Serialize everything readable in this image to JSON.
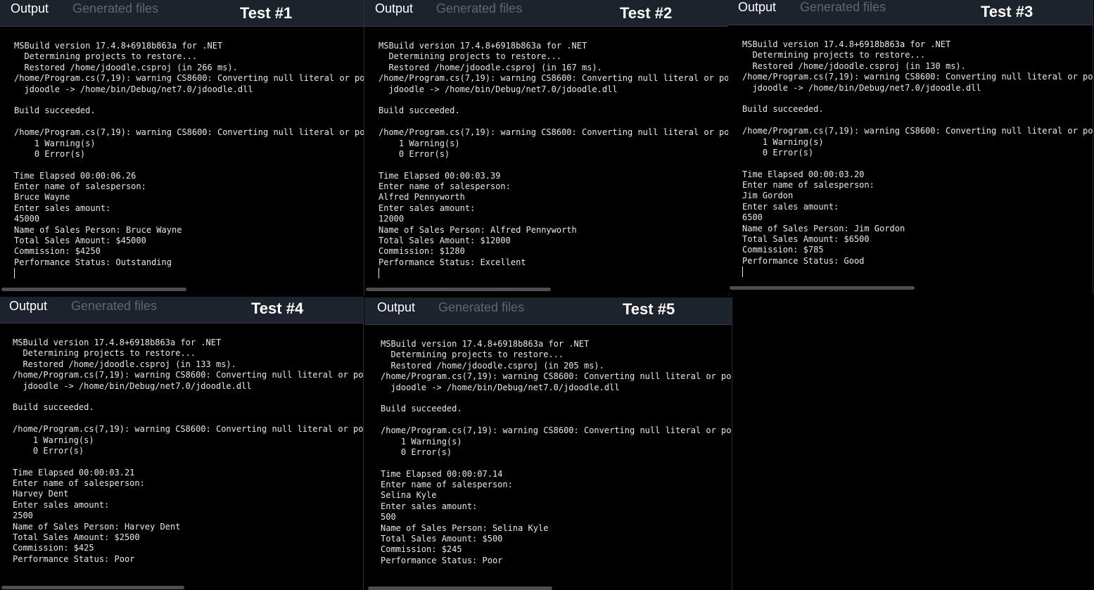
{
  "tabs": {
    "output": "Output",
    "generated_files": "Generated files"
  },
  "panels": [
    {
      "label": "Test #1",
      "lines": [
        "MSBuild version 17.4.8+6918b863a for .NET",
        "  Determining projects to restore...",
        "  Restored /home/jdoodle.csproj (in 266 ms).",
        "/home/Program.cs(7,19): warning CS8600: Converting null literal or po",
        "  jdoodle -> /home/bin/Debug/net7.0/jdoodle.dll",
        "",
        "Build succeeded.",
        "",
        "/home/Program.cs(7,19): warning CS8600: Converting null literal or po",
        "    1 Warning(s)",
        "    0 Error(s)",
        "",
        "Time Elapsed 00:00:06.26",
        "Enter name of salesperson:",
        "Bruce Wayne",
        "Enter sales amount:",
        "45000",
        "Name of Sales Person: Bruce Wayne",
        "Total Sales Amount: $45000",
        "Commission: $4250",
        "Performance Status: Outstanding"
      ]
    },
    {
      "label": "Test #2",
      "lines": [
        "MSBuild version 17.4.8+6918b863a for .NET",
        "  Determining projects to restore...",
        "  Restored /home/jdoodle.csproj (in 167 ms).",
        "/home/Program.cs(7,19): warning CS8600: Converting null literal or po",
        "  jdoodle -> /home/bin/Debug/net7.0/jdoodle.dll",
        "",
        "Build succeeded.",
        "",
        "/home/Program.cs(7,19): warning CS8600: Converting null literal or po",
        "    1 Warning(s)",
        "    0 Error(s)",
        "",
        "Time Elapsed 00:00:03.39",
        "Enter name of salesperson:",
        "Alfred Pennyworth",
        "Enter sales amount:",
        "12000",
        "Name of Sales Person: Alfred Pennyworth",
        "Total Sales Amount: $12000",
        "Commission: $1280",
        "Performance Status: Excellent"
      ]
    },
    {
      "label": "Test #3",
      "lines": [
        "MSBuild version 17.4.8+6918b863a for .NET",
        "  Determining projects to restore...",
        "  Restored /home/jdoodle.csproj (in 130 ms).",
        "/home/Program.cs(7,19): warning CS8600: Converting null literal or po",
        "  jdoodle -> /home/bin/Debug/net7.0/jdoodle.dll",
        "",
        "Build succeeded.",
        "",
        "/home/Program.cs(7,19): warning CS8600: Converting null literal or po",
        "    1 Warning(s)",
        "    0 Error(s)",
        "",
        "Time Elapsed 00:00:03.20",
        "Enter name of salesperson:",
        "Jim Gordon",
        "Enter sales amount:",
        "6500",
        "Name of Sales Person: Jim Gordon",
        "Total Sales Amount: $6500",
        "Commission: $785",
        "Performance Status: Good"
      ]
    },
    {
      "label": "Test #4",
      "lines": [
        "MSBuild version 17.4.8+6918b863a for .NET",
        "  Determining projects to restore...",
        "  Restored /home/jdoodle.csproj (in 133 ms).",
        "/home/Program.cs(7,19): warning CS8600: Converting null literal or po",
        "  jdoodle -> /home/bin/Debug/net7.0/jdoodle.dll",
        "",
        "Build succeeded.",
        "",
        "/home/Program.cs(7,19): warning CS8600: Converting null literal or po",
        "    1 Warning(s)",
        "    0 Error(s)",
        "",
        "Time Elapsed 00:00:03.21",
        "Enter name of salesperson:",
        "Harvey Dent",
        "Enter sales amount:",
        "2500",
        "Name of Sales Person: Harvey Dent",
        "Total Sales Amount: $2500",
        "Commission: $425",
        "Performance Status: Poor"
      ]
    },
    {
      "label": "Test #5",
      "lines": [
        "MSBuild version 17.4.8+6918b863a for .NET",
        "  Determining projects to restore...",
        "  Restored /home/jdoodle.csproj (in 205 ms).",
        "/home/Program.cs(7,19): warning CS8600: Converting null literal or po",
        "  jdoodle -> /home/bin/Debug/net7.0/jdoodle.dll",
        "",
        "Build succeeded.",
        "",
        "/home/Program.cs(7,19): warning CS8600: Converting null literal or po",
        "    1 Warning(s)",
        "    0 Error(s)",
        "",
        "Time Elapsed 00:00:07.14",
        "Enter name of salesperson:",
        "Selina Kyle",
        "Enter sales amount:",
        "500",
        "Name of Sales Person: Selina Kyle",
        "Total Sales Amount: $500",
        "Commission: $245",
        "Performance Status: Poor"
      ]
    }
  ]
}
